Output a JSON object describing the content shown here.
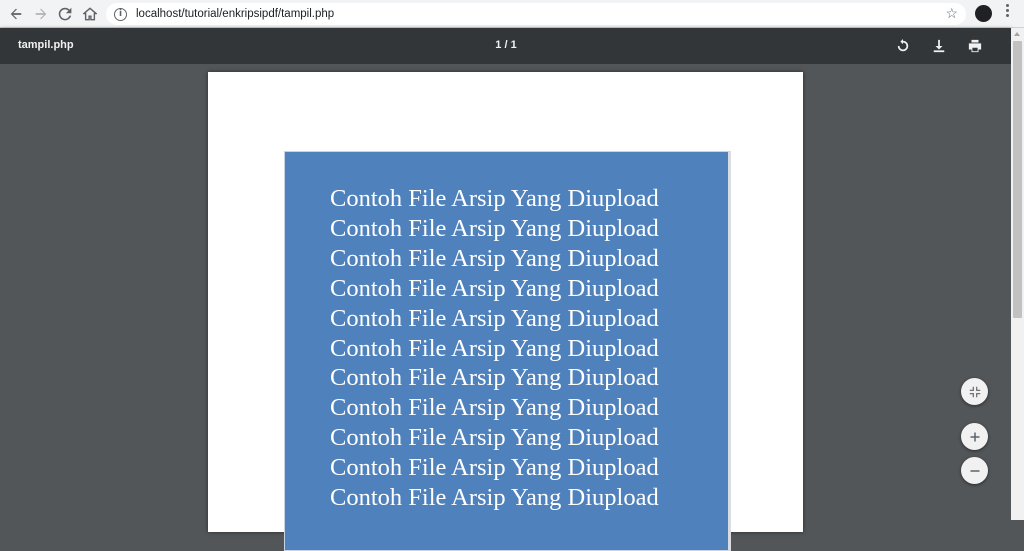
{
  "browser": {
    "url": "localhost/tutorial/enkripsipdf/tampil.php",
    "back_icon": "arrow-left-icon",
    "forward_icon": "arrow-right-icon",
    "reload_icon": "reload-icon",
    "home_icon": "home-icon",
    "info_icon": "info-icon",
    "info_glyph": "i",
    "bookmark_icon": "star-icon",
    "bookmark_glyph": "☆",
    "menu_icon": "kebab-menu-icon"
  },
  "pdf_viewer": {
    "title": "tampil.php",
    "page_indicator": "1 / 1",
    "toolbar_icons": [
      "rotate-icon",
      "download-icon",
      "print-icon"
    ],
    "zoom_controls": [
      "fit-to-page-icon",
      "zoom-in-icon",
      "zoom-out-icon"
    ],
    "colors": {
      "toolbar": "#323639",
      "background": "#525659",
      "document_box": "#4f81bd",
      "document_text": "#ffffff"
    }
  },
  "document": {
    "lines": [
      "Contoh File Arsip Yang Diupload",
      "Contoh File Arsip Yang Diupload",
      "Contoh File Arsip Yang Diupload",
      "Contoh File Arsip Yang Diupload",
      "Contoh File Arsip Yang Diupload",
      "Contoh File Arsip Yang Diupload",
      "Contoh File Arsip Yang Diupload",
      "Contoh File Arsip Yang Diupload",
      "Contoh File Arsip Yang Diupload",
      "Contoh File Arsip Yang Diupload",
      "Contoh File Arsip Yang Diupload"
    ]
  }
}
